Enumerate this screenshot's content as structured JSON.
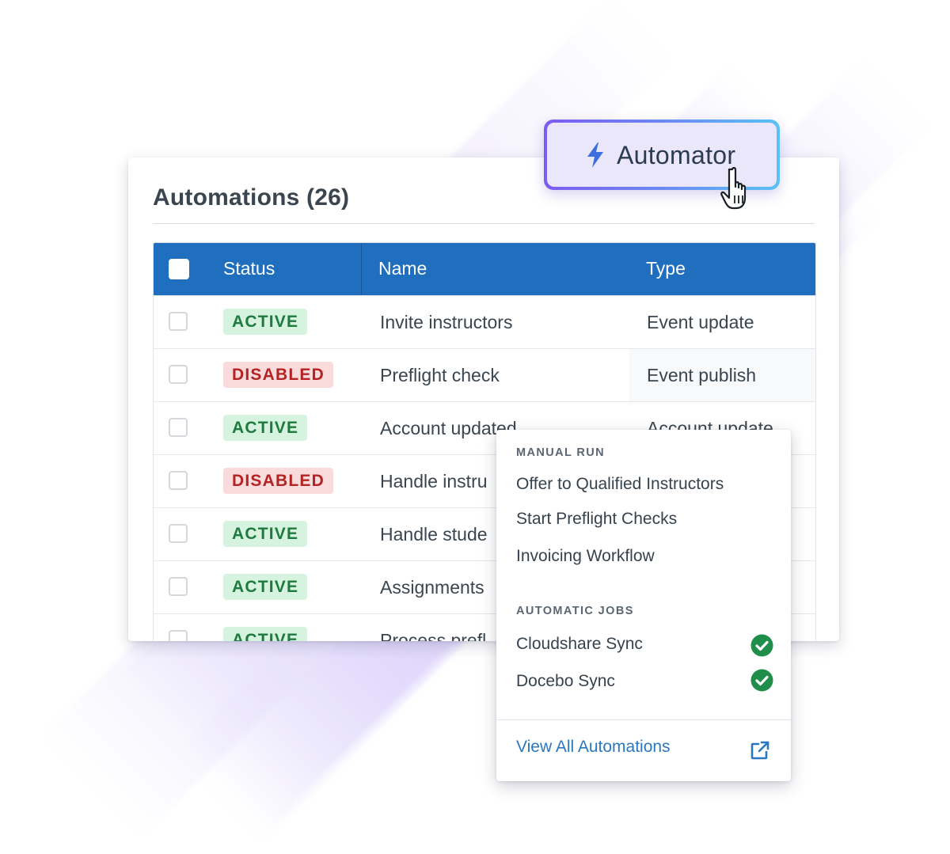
{
  "colors": {
    "header_blue": "#1f6fbe",
    "active_bg": "#d6f3df",
    "active_text": "#1e7a3e",
    "disabled_bg": "#fadbdb",
    "disabled_text": "#b42323",
    "link_blue": "#2a78c0",
    "check_green": "#1e8e4a",
    "automator_border_start": "#7b5cf0",
    "automator_border_end": "#59c2f4"
  },
  "card": {
    "title": "Automations (26)"
  },
  "table": {
    "columns": [
      "Status",
      "Name",
      "Type"
    ],
    "rows": [
      {
        "status": "ACTIVE",
        "status_kind": "active",
        "name": "Invite instructors",
        "type": "Event update"
      },
      {
        "status": "DISABLED",
        "status_kind": "disabled",
        "name": "Preflight check",
        "type": "Event publish"
      },
      {
        "status": "ACTIVE",
        "status_kind": "active",
        "name": "Account updated",
        "type": "Account update"
      },
      {
        "status": "DISABLED",
        "status_kind": "disabled",
        "name": "Handle instru",
        "type": ""
      },
      {
        "status": "ACTIVE",
        "status_kind": "active",
        "name": "Handle stude",
        "type": ""
      },
      {
        "status": "ACTIVE",
        "status_kind": "active",
        "name": "Assignments",
        "type": ""
      },
      {
        "status": "ACTIVE",
        "status_kind": "active",
        "name": "Process prefl",
        "type": ""
      }
    ]
  },
  "automator_button": {
    "label": "Automator",
    "icon": "lightning-bolt-icon"
  },
  "menu": {
    "manual_run_title": "MANUAL RUN",
    "manual_items": [
      "Offer to Qualified Instructors",
      "Start Preflight Checks",
      "Invoicing Workflow"
    ],
    "automatic_title": "AUTOMATIC JOBS",
    "automatic_items": [
      {
        "label": "Cloudshare Sync",
        "status_icon": "check-circle-icon"
      },
      {
        "label": "Docebo Sync",
        "status_icon": "check-circle-icon"
      }
    ],
    "view_all_label": "View All Automations",
    "view_all_icon": "external-link-icon"
  }
}
